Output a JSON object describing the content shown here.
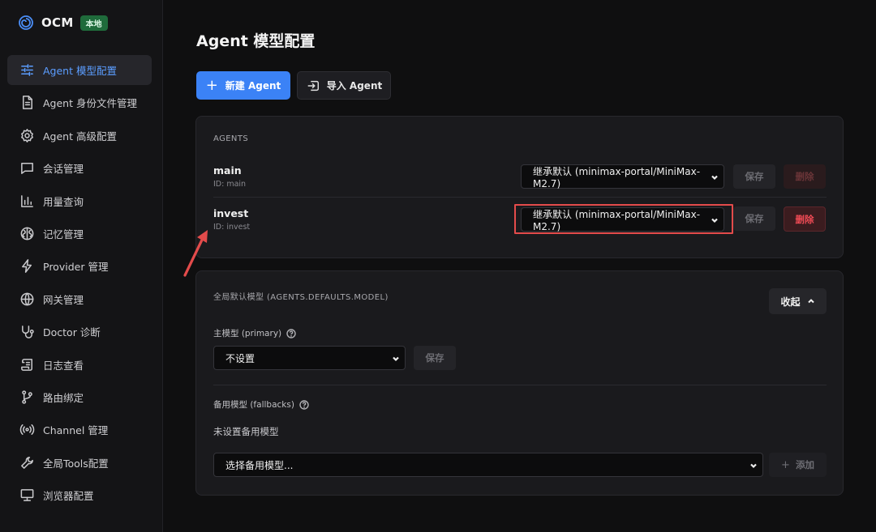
{
  "brand": {
    "name": "OCM",
    "badge": "本地"
  },
  "sidebar": {
    "items": [
      {
        "label": "Agent 模型配置",
        "icon": "sliders-icon",
        "active": true
      },
      {
        "label": "Agent 身份文件管理",
        "icon": "file-icon"
      },
      {
        "label": "Agent 高级配置",
        "icon": "gear-icon"
      },
      {
        "label": "会话管理",
        "icon": "chat-icon"
      },
      {
        "label": "用量查询",
        "icon": "bar-chart-icon"
      },
      {
        "label": "记忆管理",
        "icon": "brain-icon"
      },
      {
        "label": "Provider 管理",
        "icon": "bolt-icon"
      },
      {
        "label": "网关管理",
        "icon": "globe-icon"
      },
      {
        "label": "Doctor 诊断",
        "icon": "stethoscope-icon"
      },
      {
        "label": "日志查看",
        "icon": "scroll-icon"
      },
      {
        "label": "路由绑定",
        "icon": "git-branch-icon"
      },
      {
        "label": "Channel 管理",
        "icon": "radio-icon"
      },
      {
        "label": "全局Tools配置",
        "icon": "wrench-icon"
      },
      {
        "label": "浏览器配置",
        "icon": "monitor-icon"
      }
    ]
  },
  "main": {
    "title": "Agent 模型配置",
    "new_agent_label": "新建 Agent",
    "import_agent_label": "导入 Agent",
    "agents_section_label": "AGENTS",
    "agents": [
      {
        "name": "main",
        "id_text": "ID: main",
        "model": "继承默认 (minimax-portal/MiniMax-M2.7)",
        "save_label": "保存",
        "delete_label": "删除"
      },
      {
        "name": "invest",
        "id_text": "ID: invest",
        "model": "继承默认 (minimax-portal/MiniMax-M2.7)",
        "save_label": "保存",
        "delete_label": "删除"
      }
    ],
    "defaults": {
      "section_label": "全局默认模型 (AGENTS.DEFAULTS.MODEL)",
      "collapse_label": "收起",
      "primary_label": "主模型 (primary)",
      "primary_value": "不设置",
      "primary_save_label": "保存",
      "fallbacks_label": "备用模型 (fallbacks)",
      "fallbacks_empty": "未设置备用模型",
      "fallback_select_placeholder": "选择备用模型...",
      "add_label": "添加"
    }
  },
  "colors": {
    "accent": "#3b82f6",
    "active_nav_text": "#5b9dff",
    "danger": "#f04b55",
    "highlight": "#e34b4b",
    "badge_bg": "#1f6b3b"
  }
}
